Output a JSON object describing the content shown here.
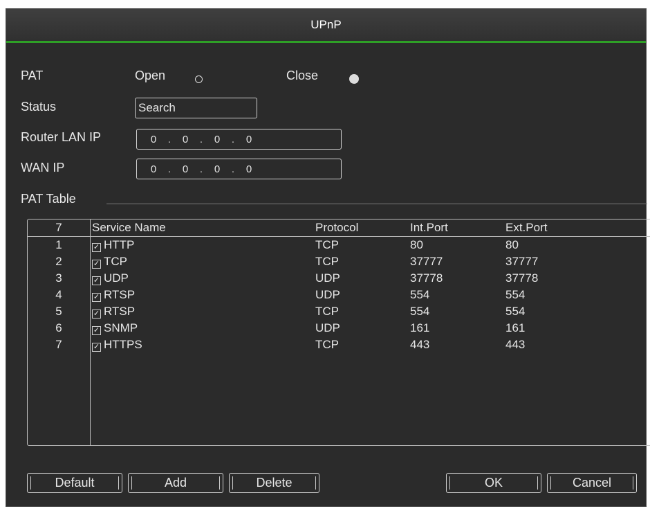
{
  "title": "UPnP",
  "pat": {
    "label": "PAT",
    "open_label": "Open",
    "close_label": "Close",
    "selected": "Close"
  },
  "status": {
    "label": "Status",
    "value": "Search"
  },
  "router_lan_ip": {
    "label": "Router LAN IP",
    "octets": [
      "0",
      "0",
      "0",
      "0"
    ]
  },
  "wan_ip": {
    "label": "WAN IP",
    "octets": [
      "0",
      "0",
      "0",
      "0"
    ]
  },
  "pat_table": {
    "label": "PAT Table",
    "headers": {
      "count": "7",
      "service": "Service Name",
      "protocol": "Protocol",
      "int_port": "Int.Port",
      "ext_port": "Ext.Port"
    },
    "rows": [
      {
        "num": "1",
        "service": "HTTP",
        "protocol": "TCP",
        "int_port": "80",
        "ext_port": "80",
        "checked": true
      },
      {
        "num": "2",
        "service": "TCP",
        "protocol": "TCP",
        "int_port": "37777",
        "ext_port": "37777",
        "checked": true
      },
      {
        "num": "3",
        "service": "UDP",
        "protocol": "UDP",
        "int_port": "37778",
        "ext_port": "37778",
        "checked": true
      },
      {
        "num": "4",
        "service": "RTSP",
        "protocol": "UDP",
        "int_port": "554",
        "ext_port": "554",
        "checked": true
      },
      {
        "num": "5",
        "service": "RTSP",
        "protocol": "TCP",
        "int_port": "554",
        "ext_port": "554",
        "checked": true
      },
      {
        "num": "6",
        "service": "SNMP",
        "protocol": "UDP",
        "int_port": "161",
        "ext_port": "161",
        "checked": true
      },
      {
        "num": "7",
        "service": "HTTPS",
        "protocol": "TCP",
        "int_port": "443",
        "ext_port": "443",
        "checked": true
      }
    ]
  },
  "buttons": {
    "default": "Default",
    "add": "Add",
    "delete": "Delete",
    "ok": "OK",
    "cancel": "Cancel"
  },
  "colors": {
    "accent": "#2e9f26",
    "background": "#2b2b2b"
  },
  "icons": {
    "checkbox": "check-icon",
    "radio": "radio-icon"
  }
}
